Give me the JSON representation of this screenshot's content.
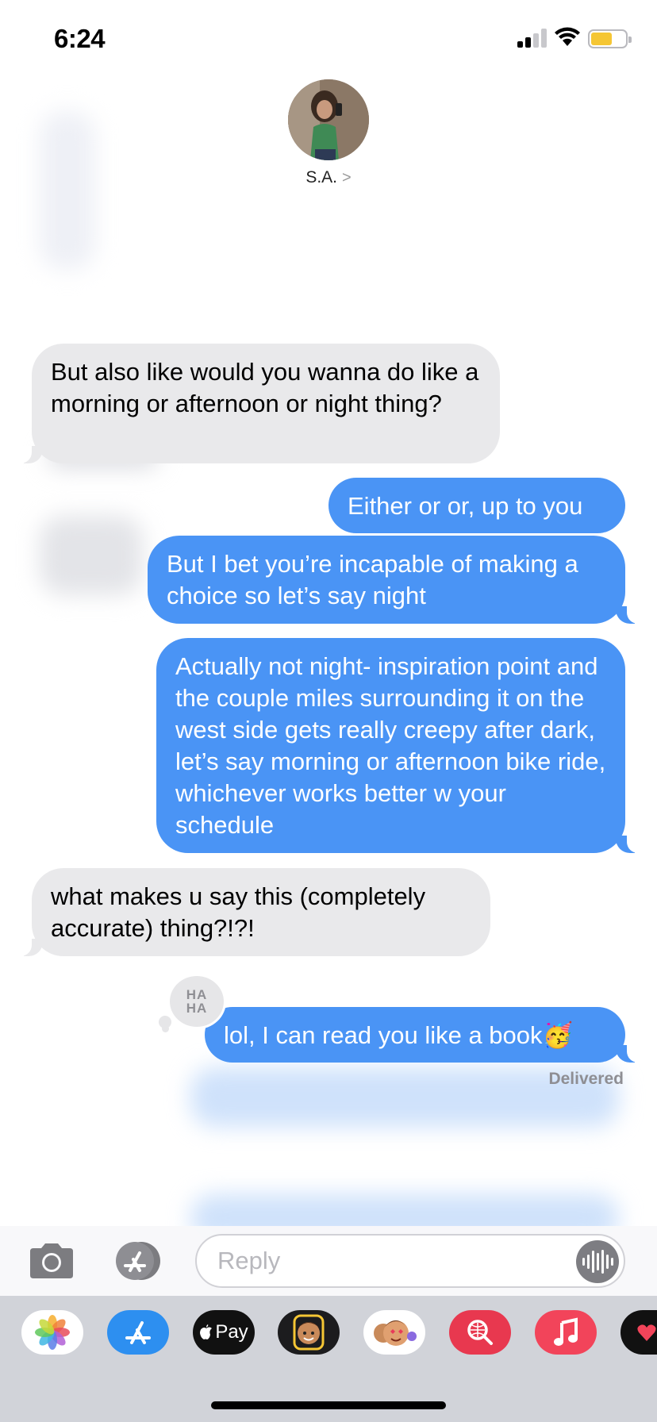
{
  "status_bar": {
    "time": "6:24"
  },
  "contact": {
    "name": "S.A.",
    "chevron": ">"
  },
  "messages": [
    {
      "direction": "incoming",
      "text": "But also like would you wanna do like a morning or afternoon or night thing?"
    },
    {
      "direction": "outgoing",
      "text": "Either or or, up to you"
    },
    {
      "direction": "outgoing",
      "text": "But I bet you’re incapable of making a choice so let’s say night"
    },
    {
      "direction": "outgoing",
      "text": "Actually not night- inspiration point and the couple miles surrounding it on the west side gets really creepy after dark, let’s say morning or afternoon bike ride, whichever works better w your schedule"
    },
    {
      "direction": "incoming",
      "text": "what makes u say this (completely accurate) thing?!?!"
    },
    {
      "direction": "outgoing",
      "text": "lol, I can read you like a book🥳"
    }
  ],
  "tapback": {
    "line1": "HA",
    "line2": "HA"
  },
  "delivered_label": "Delivered",
  "input": {
    "placeholder": "Reply"
  },
  "app_drawer": [
    "photos-icon",
    "app-store-icon",
    "apple-pay-icon",
    "memoji-stickers-icon",
    "animoji-icon",
    "images-search-icon",
    "music-icon",
    "digital-touch-icon"
  ],
  "apple_pay_label": "Pay",
  "colors": {
    "outgoing_bubble": "#4a94f5",
    "incoming_bubble": "#e9e9eb",
    "battery": "#f5c634"
  }
}
